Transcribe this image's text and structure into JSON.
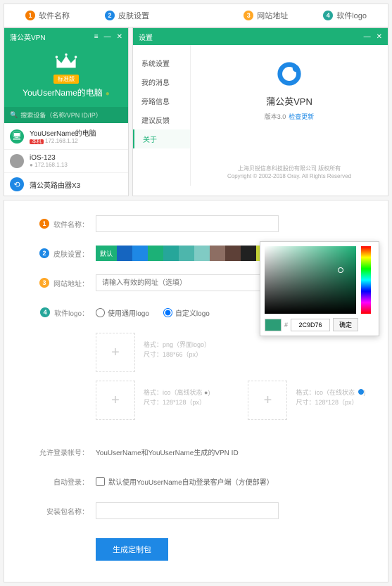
{
  "legend": {
    "i1": "软件名称",
    "i2": "皮肤设置",
    "i3": "网站地址",
    "i4": "软件logo"
  },
  "leftWin": {
    "title": "蒲公英VPN",
    "badge": "标准版",
    "heroName": "YouUserName的电脑",
    "searchPlaceholder": "搜索设备（名称/VPN ID/IP）",
    "devices": [
      {
        "name": "YouUserName的电脑",
        "ip": "172.168.1.12",
        "pill": "本机"
      },
      {
        "name": "iOS-123",
        "ip": "172.168.1.13",
        "pill": ""
      },
      {
        "name": "蒲公英路由器X3",
        "ip": "",
        "pill": ""
      }
    ]
  },
  "rightWin": {
    "title": "设置",
    "menu": [
      "系统设置",
      "我的消息",
      "旁路信息",
      "建议反馈",
      "关于"
    ],
    "appName": "蒲公英VPN",
    "versionPrefix": "版本3.0",
    "checkUpdate": "检查更新",
    "copyright1": "上海贝锐信息科技股份有限公司 版权所有",
    "copyright2": "Copyright © 2002-2018 Oray. All Rights Reserved"
  },
  "form": {
    "l1": "软件名称：",
    "l2": "皮肤设置：",
    "l3": "网站地址：",
    "l4": "软件logo：",
    "swDefault": "默认",
    "urlPlaceholder": "请输入有效的网址（选填）",
    "radioGeneric": "使用通用logo",
    "radioCustom": "自定义logo",
    "up1a": "格式：png（界面logo）",
    "up1b": "尺寸：188*66（px）",
    "up2a": "格式：ico（离线状态",
    "up2b": "尺寸：128*128（px）",
    "up3a": "格式：ico（在线状态",
    "up3b": "尺寸：128*128（px）",
    "lAllow": "允许登录帐号：",
    "allowVal": "YouUserName和YouUserName生成的VPN ID",
    "lAuto": "自动登录：",
    "autoChk": "默认使用YouUserName自动登录客户端（方便部署）",
    "lPkg": "安装包名称：",
    "submit": "生成定制包"
  },
  "picker": {
    "hex": "2C9D76",
    "ok": "确定"
  },
  "swatches": [
    "#1565c0",
    "#1e88e5",
    "#1cb177",
    "#26a69a",
    "#4db6ac",
    "#80cbc4",
    "#8d6e63",
    "#5d4037",
    "#212121",
    "#cddc39",
    "#d4b483",
    "#c9a86a"
  ]
}
